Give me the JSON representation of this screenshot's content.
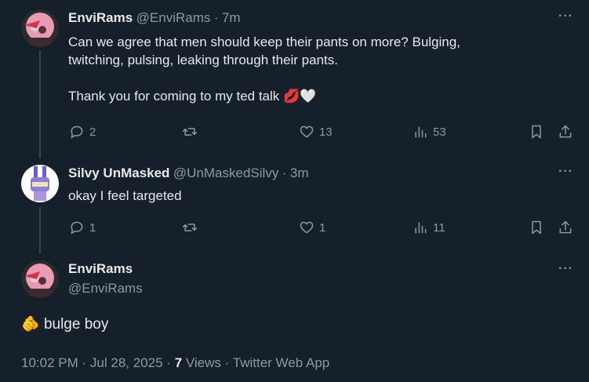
{
  "tweets": [
    {
      "display_name": "EnviRams",
      "handle": "@EnviRams",
      "time": "7m",
      "text_line1": "Can we agree that men should keep their pants on more? Bulging,",
      "text_line2": "twitching, pulsing, leaking through their pants.",
      "text_line3": "Thank you for coming to my ted talk",
      "emojis": "💋🤍",
      "replies": "2",
      "retweets": "",
      "likes": "13",
      "views": "53"
    },
    {
      "display_name": "Silvy UnMasked",
      "handle": "@UnMaskedSilvy",
      "time": "3m",
      "text": "okay I feel targeted",
      "replies": "1",
      "retweets": "",
      "likes": "1",
      "views": "11"
    }
  ],
  "main": {
    "display_name": "EnviRams",
    "handle": "@EnviRams",
    "emoji": "🫵",
    "text": "bulge boy",
    "time": "10:02 PM",
    "date": "Jul 28, 2025",
    "views_count": "7",
    "views_label": "Views",
    "source": "Twitter Web App"
  },
  "colors": {
    "background": "#15202b",
    "text": "#e7e9ea",
    "muted": "#8b98a5",
    "thread": "#38444d"
  },
  "icons": [
    "reply-icon",
    "retweet-icon",
    "like-icon",
    "views-icon",
    "bookmark-icon",
    "share-icon",
    "more-icon"
  ]
}
